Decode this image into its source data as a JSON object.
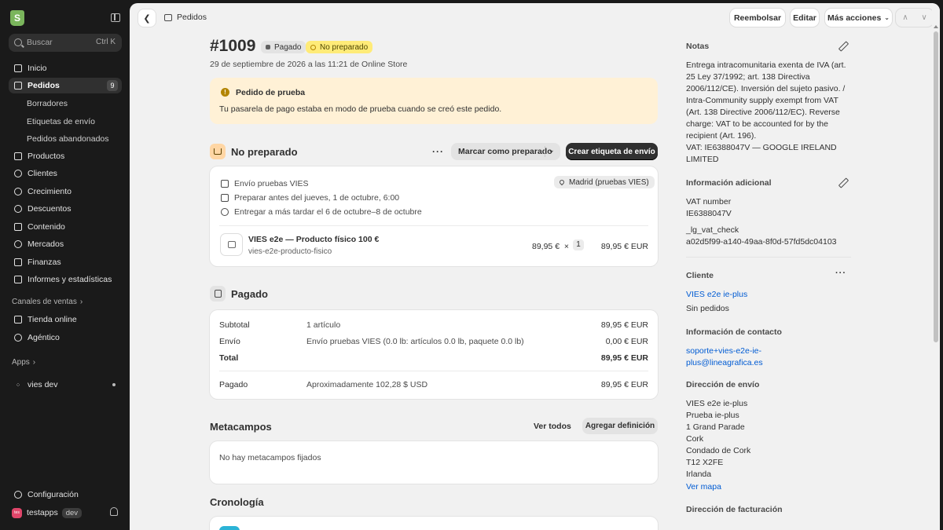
{
  "sidebar": {
    "search": {
      "placeholder": "Buscar",
      "shortcut": "Ctrl K"
    },
    "items": [
      {
        "label": "Inicio",
        "icon": "home-icon"
      },
      {
        "label": "Pedidos",
        "icon": "orders-icon",
        "badge": "9",
        "active": true
      },
      {
        "label": "Productos",
        "icon": "tag-icon"
      },
      {
        "label": "Clientes",
        "icon": "person-icon"
      },
      {
        "label": "Crecimiento",
        "icon": "target-icon"
      },
      {
        "label": "Descuentos",
        "icon": "discount-icon"
      },
      {
        "label": "Contenido",
        "icon": "content-icon"
      },
      {
        "label": "Mercados",
        "icon": "globe-icon"
      },
      {
        "label": "Finanzas",
        "icon": "bank-icon"
      },
      {
        "label": "Informes y estadísticas",
        "icon": "chart-icon"
      }
    ],
    "subitems": [
      "Borradores",
      "Etiquetas de envío",
      "Pedidos abandonados"
    ],
    "sales_channels_title": "Canales de ventas",
    "channels": [
      {
        "label": "Tienda online",
        "icon": "store-icon"
      },
      {
        "label": "Agéntico",
        "icon": "agent-icon"
      }
    ],
    "apps_title": "Apps",
    "app_item": "vies dev",
    "settings": "Configuración",
    "user": {
      "initials": "tes",
      "name": "testapps",
      "tag": "dev"
    }
  },
  "topbar": {
    "breadcrumb": "Pedidos",
    "refund": "Reembolsar",
    "edit": "Editar",
    "more_actions": "Más acciones"
  },
  "order": {
    "number": "#1009",
    "payment_status": "Pagado",
    "fulfillment_status": "No preparado",
    "subtitle": "29 de septiembre de 2026 a las 11:21 de Online Store"
  },
  "banner": {
    "title": "Pedido de prueba",
    "text": "Tu pasarela de pago estaba en modo de prueba cuando se creó este pedido."
  },
  "fulfillment": {
    "title": "No preparado",
    "mark_btn": "Marcar como preparado",
    "create_btn": "Crear etiqueta de envío",
    "shipping_method": "Envío pruebas VIES",
    "prepare_by": "Preparar antes del jueves, 1 de octubre, 6:00",
    "deliver_by": "Entregar a más tardar el 6 de octubre–8 de octubre",
    "location": "Madrid (pruebas VIES)",
    "product": {
      "name": "VIES e2e — Producto físico 100 €",
      "sku": "vies-e2e-producto-fisico",
      "unit_price": "89,95 €",
      "times": "×",
      "qty": "1",
      "total": "89,95 € EUR"
    }
  },
  "payment": {
    "title": "Pagado",
    "rows": [
      {
        "label": "Subtotal",
        "detail": "1 artículo",
        "amount": "89,95 € EUR"
      },
      {
        "label": "Envío",
        "detail": "Envío pruebas VIES (0.0 lb: artículos 0.0 lb, paquete 0.0 lb)",
        "amount": "0,00 € EUR"
      },
      {
        "label": "Total",
        "detail": "",
        "amount": "89,95 € EUR"
      },
      {
        "label": "Pagado",
        "detail": "Aproximadamente 102,28 $ USD",
        "amount": "89,95 € EUR"
      }
    ]
  },
  "metafields": {
    "title": "Metacampos",
    "view_all": "Ver todos",
    "add_definition": "Agregar definición",
    "empty": "No hay metacampos fijados"
  },
  "timeline": {
    "title": "Cronología"
  },
  "right": {
    "notes_title": "Notas",
    "notes_lines": [
      "Entrega intracomunitaria exenta de IVA (art.",
      "25 Ley 37/1992; art. 138 Directiva",
      "2006/112/CE). Inversión del sujeto pasivo. /",
      "Intra-Community supply exempt from VAT",
      "(Art. 138 Directive 2006/112/EC). Reverse",
      "charge: VAT to be accounted for by the",
      "recipient (Art. 196).",
      "VAT: IE6388047V — GOOGLE IRELAND",
      "LIMITED"
    ],
    "additional_title": "Información adicional",
    "vat_label": "VAT number",
    "vat_value": "IE6388047V",
    "check_label": "_lg_vat_check",
    "check_value": "a02d5f99-a140-49aa-8f0d-57fd5dc04103",
    "customer_title": "Cliente",
    "customer_name": "VIES e2e ie-plus",
    "customer_orders": "Sin pedidos",
    "contact_title": "Información de contacto",
    "contact_lines": [
      "soporte+vies-e2e-ie-",
      "plus@lineagrafica.es"
    ],
    "shipping_title": "Dirección de envío",
    "shipping_lines": [
      "VIES e2e ie-plus",
      "Prueba ie-plus",
      "1 Grand Parade",
      "Cork",
      "Condado de Cork",
      "T12 X2FE",
      "Irlanda"
    ],
    "view_map": "Ver mapa",
    "billing_title": "Dirección de facturación"
  }
}
